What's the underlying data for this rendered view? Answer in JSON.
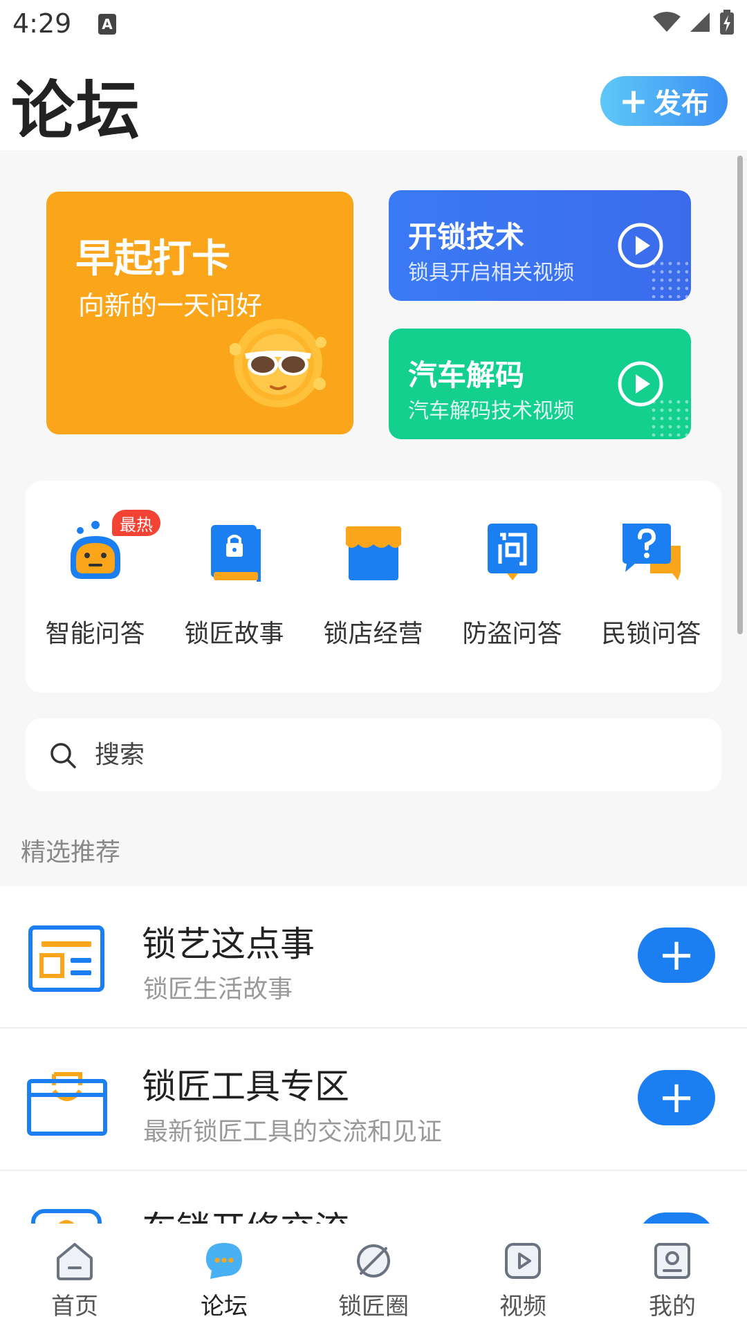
{
  "status_bar": {
    "time": "4:29",
    "notification_letter": "A"
  },
  "header": {
    "title": "论坛",
    "publish_label": "发布"
  },
  "banners": {
    "morning": {
      "title": "早起打卡",
      "subtitle": "向新的一天问好"
    },
    "unlock": {
      "title": "开锁技术",
      "subtitle": "锁具开启相关视频"
    },
    "car": {
      "title": "汽车解码",
      "subtitle": "汽车解码技术视频"
    }
  },
  "categories": [
    {
      "label": "智能问答",
      "icon": "robot-icon",
      "badge": "最热"
    },
    {
      "label": "锁匠故事",
      "icon": "lock-book-icon"
    },
    {
      "label": "锁店经营",
      "icon": "storefront-icon"
    },
    {
      "label": "防盗问答",
      "icon": "question-chat-icon"
    },
    {
      "label": "民锁问答",
      "icon": "help-bubble-icon"
    }
  ],
  "search": {
    "placeholder": "搜索"
  },
  "section": {
    "title": "精选推荐"
  },
  "forums": [
    {
      "title": "锁艺这点事",
      "subtitle": "锁匠生活故事",
      "icon": "news-card-icon"
    },
    {
      "title": "锁匠工具专区",
      "subtitle": "最新锁匠工具的交流和见证",
      "icon": "toolbox-icon"
    },
    {
      "title": "车锁开修交流",
      "subtitle": "",
      "icon": "car-lock-icon"
    }
  ],
  "colors": {
    "accent": "#1b7ff1",
    "orange": "#fba51a",
    "green": "#14d08f",
    "blue_card": "#3b7af5"
  },
  "bottom_nav": [
    {
      "label": "首页",
      "icon": "home-icon",
      "active": false
    },
    {
      "label": "论坛",
      "icon": "forum-chat-icon",
      "active": true
    },
    {
      "label": "锁匠圈",
      "icon": "planet-icon",
      "active": false
    },
    {
      "label": "视频",
      "icon": "video-play-icon",
      "active": false
    },
    {
      "label": "我的",
      "icon": "profile-icon",
      "active": false
    }
  ]
}
